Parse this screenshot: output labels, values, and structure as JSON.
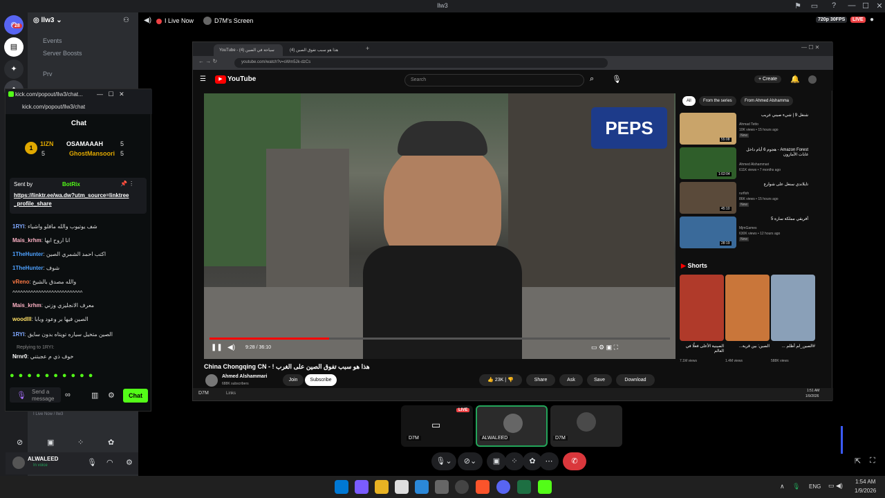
{
  "app_title": "llw3",
  "server": {
    "name": "llw3",
    "channels": [
      "Events",
      "Server Boosts",
      "Prv"
    ],
    "rail_badges": [
      "28",
      "64"
    ]
  },
  "stream_bar": {
    "live_label": "I Live Now",
    "screen_label": "D7M's Screen",
    "quality": "720p 30FPS",
    "live_badge": "LIVE"
  },
  "browser": {
    "tabs": [
      "YouTube - سياحة في الصين (4)",
      "هذا هو سبب تفوق الصين (4)"
    ],
    "url": "youtube.com/watch?v=sWm5Jk-dzCs",
    "search_placeholder": "Search",
    "create_label": "Create",
    "notif_count": "9+"
  },
  "video": {
    "time": "9:28 / 36:10",
    "progress": 0.26,
    "title": "China Chongqing CN - ! هذا هو سبب تفوق الصين على الغرب",
    "channel": "Ahmed Alshammari",
    "subs": "688K subscribers",
    "join": "Join",
    "subscribe": "Subscribe",
    "likes": "23K",
    "share": "Share",
    "ask": "Ask",
    "save": "Save",
    "download": "Download"
  },
  "chips": [
    "All",
    "From the series",
    "From Ahmed Alshamma"
  ],
  "recs": [
    {
      "title": "شنغل 9 | شيء صيني غريب",
      "channel": "Ahmad Tetto",
      "meta": "10K views • 15 hours ago",
      "dur": "55:08",
      "badge": "New"
    },
    {
      "title": "Amazon Forest - هجوم 6 أيام داخل غابات الأمازون",
      "channel": "Ahmed Alshammari",
      "meta": "611K views • 7 months ago",
      "dur": "1:02:04",
      "badge": ""
    },
    {
      "title": "تايلاندي سنغل على شوارع",
      "channel": "rurfloh",
      "meta": "86K views • 15 hours ago",
      "dur": "45:10",
      "badge": "New"
    },
    {
      "title": "أفريقي مملكة سارة 5",
      "channel": "MjmGames",
      "meta": "630K views • 12 hours ago",
      "dur": "28:19",
      "badge": "New"
    }
  ],
  "shorts_label": "Shorts",
  "shorts": [
    {
      "title": "الصينية الأعلى فعلًا في العالم",
      "views": "7.1M views"
    },
    {
      "title": "الصين: بين قرية...",
      "views": "1.4M views"
    },
    {
      "title": "#الصين_لم أظلم ...",
      "views": "588K views"
    }
  ],
  "browser_taskbar": {
    "time": "1:51 AM",
    "date": "1/9/2026",
    "left_label": "D7M",
    "links": "Links"
  },
  "kick": {
    "window_title": "kick.com/popout/llw3/chat...",
    "url": "kick.com/popout/llw3/chat",
    "header": "Chat",
    "leaders": [
      {
        "name": "1IZN",
        "count": "5"
      },
      {
        "name": "OSAMAAAH",
        "count": "5"
      },
      {
        "name": "GhostMansoori",
        "count": "5"
      }
    ],
    "pinned_by": "Sent by",
    "pinned_user": "BotRix",
    "pinned_link": "https://linktr.ee/wa.dw?utm_source=linktree_profile_share",
    "messages": [
      {
        "user": "1RYI",
        "text": "شف يوتيوب والله مافلو واشياء"
      },
      {
        "user": "Mais_krhm",
        "text": "انا اروح ابها"
      },
      {
        "user": "1TheHunter",
        "text": "اكتب احمد الشمري الصين"
      },
      {
        "user": "1TheHunter",
        "text": "شوف"
      },
      {
        "user": "vReno",
        "text": "والله مصدق بالشيخ"
      },
      {
        "user": "",
        "text": "^^^^^^^^^^^^^^^^^^^^^^^^^^^"
      },
      {
        "user": "Mais_krhm",
        "text": "معرف الانجليزي وزني"
      },
      {
        "user": "woodlll",
        "text": "الصين فيها بر وعود وبابا"
      },
      {
        "user": "1RYI",
        "text": "الصين متخيل سياره تويتاه بدون سايق"
      },
      {
        "user": "Nrnr0",
        "text": "خوف ذي م عجبتني"
      }
    ],
    "reply_to": "Replying to 1RYI:",
    "input_placeholder": "Send a message",
    "chat_button": "Chat"
  },
  "tiles": [
    {
      "name": "D7M",
      "live": "LIVE"
    },
    {
      "name": "ALWALEED"
    },
    {
      "name": "D7M"
    }
  ],
  "user": {
    "name": "ALWALEED",
    "status": "In voice"
  },
  "voice_footer": "I Live Now / llw3",
  "clock": {
    "time": "1:54 AM",
    "date": "1/9/2026",
    "lang": "ENG"
  }
}
